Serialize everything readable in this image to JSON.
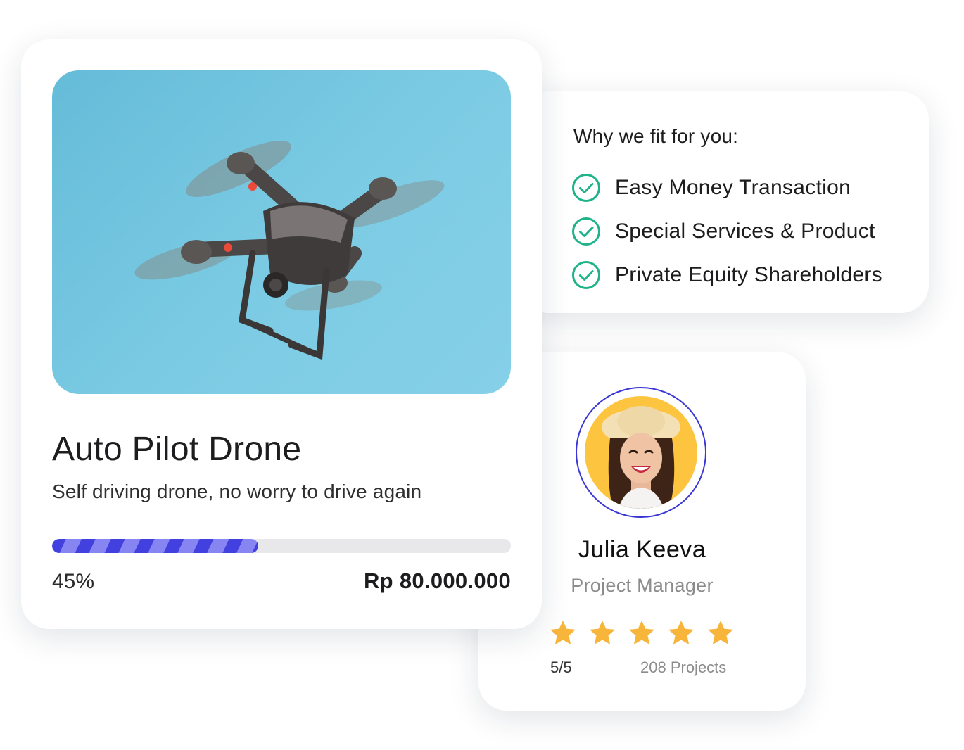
{
  "product": {
    "title": "Auto Pilot Drone",
    "description": "Self driving drone, no worry to drive again",
    "progress_percent": 45,
    "progress_label": "45%",
    "amount": "Rp 80.000.000",
    "image_icon": "drone-photo"
  },
  "fit": {
    "title": "Why we fit for you:",
    "items": [
      {
        "label": "Easy Money Transaction",
        "icon": "check-circle-icon"
      },
      {
        "label": "Special Services & Product",
        "icon": "check-circle-icon"
      },
      {
        "label": "Private Equity Shareholders",
        "icon": "check-circle-icon"
      }
    ]
  },
  "profile": {
    "name": "Julia Keeva",
    "role": "Project Manager",
    "rating_value": 5,
    "rating_max": 5,
    "rating_label": "5/5",
    "projects_label": "208 Projects",
    "avatar_icon": "avatar-photo"
  },
  "colors": {
    "accent": "#4340e0",
    "check": "#1fb38a",
    "star": "#f8b53c",
    "track": "#e8e8ea"
  }
}
